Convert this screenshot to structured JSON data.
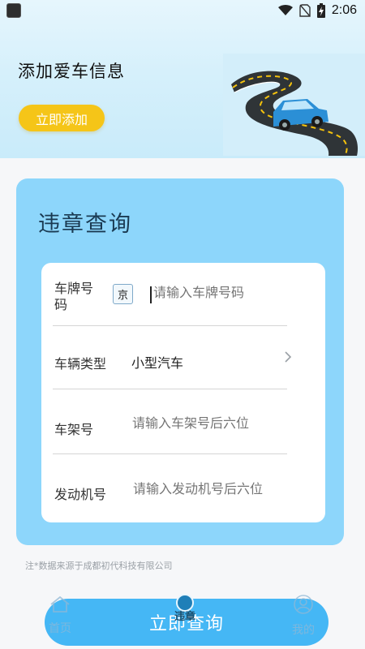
{
  "status_bar": {
    "time": "2:06",
    "icons": [
      "app-icon",
      "wifi-icon",
      "no-sim-icon",
      "battery-charging-icon"
    ]
  },
  "header": {
    "title": "添加爱车信息",
    "add_button_label": "立即添加",
    "illustration": "road-car-illustration"
  },
  "query_card": {
    "title": "违章查询",
    "fields": [
      {
        "label": "车牌号码",
        "province": "京",
        "placeholder": "请输入车牌号码"
      },
      {
        "label": "车辆类型",
        "value": "小型汽车",
        "icon": "chevron-right-icon"
      },
      {
        "label": "车架号",
        "placeholder": "请输入车架号后六位"
      },
      {
        "label": "发动机号",
        "placeholder": "请输入发动机号后六位"
      }
    ]
  },
  "footnote": "注*数据来源于成都初代科技有限公司",
  "query_button_label": "立即查询",
  "tabs": [
    {
      "label": "首页",
      "icon": "home-icon",
      "active": false
    },
    {
      "label": "违章",
      "icon": "violation-icon",
      "active": true
    },
    {
      "label": "我的",
      "icon": "profile-icon",
      "active": false
    }
  ],
  "colors": {
    "accent": "#45b7f5",
    "card": "#8dd6fb",
    "add_button": "#f5c518",
    "header": "#d6f0fb"
  }
}
